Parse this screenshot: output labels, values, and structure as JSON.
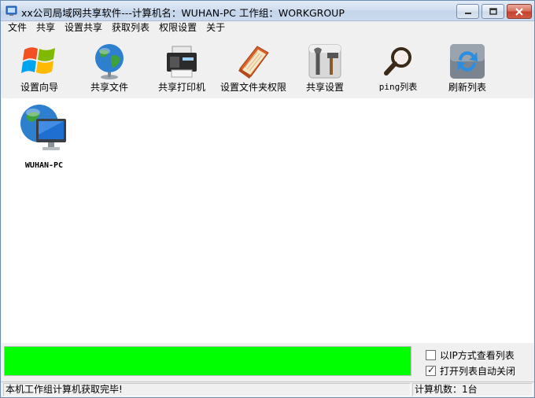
{
  "window": {
    "title": "xx公司局域网共享软件---计算机名：WUHAN-PC  工作组：WORKGROUP"
  },
  "menu": [
    "文件",
    "共享",
    "设置共享",
    "获取列表",
    "权限设置",
    "关于"
  ],
  "toolbar": [
    {
      "label": "设置向导",
      "icon": "windows-logo-icon"
    },
    {
      "label": "共享文件",
      "icon": "globe-icon"
    },
    {
      "label": "共享打印机",
      "icon": "printer-icon"
    },
    {
      "label": "设置文件夹权限",
      "icon": "folder-book-icon"
    },
    {
      "label": "共享设置",
      "icon": "tools-icon"
    },
    {
      "label": "ping列表",
      "icon": "magnifier-icon"
    },
    {
      "label": "刷新列表",
      "icon": "refresh-icon"
    }
  ],
  "computers": [
    {
      "name": "WUHAN-PC",
      "icon": "network-computer-icon"
    }
  ],
  "options": {
    "view_by_ip": {
      "label": "以IP方式查看列表",
      "checked": false
    },
    "auto_close": {
      "label": "打开列表自动关闭",
      "checked": true
    }
  },
  "progress": {
    "value": 1.0,
    "color": "#00ff00"
  },
  "status": {
    "message": "本机工作组计算机获取完毕!",
    "count": "计算机数：1台"
  }
}
